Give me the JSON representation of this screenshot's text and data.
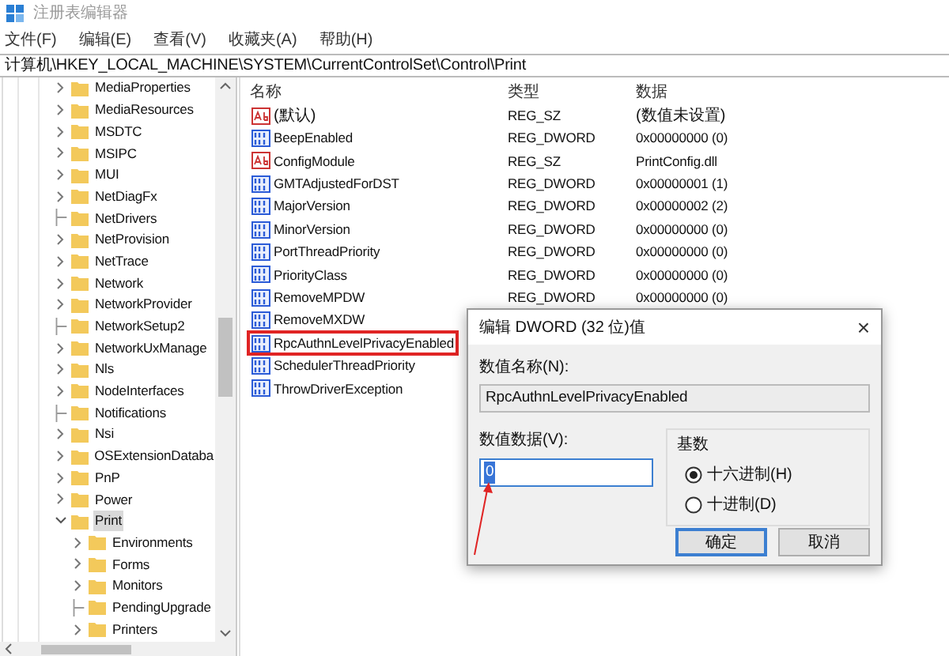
{
  "window": {
    "title": "注册表编辑器"
  },
  "menu": [
    "文件(F)",
    "编辑(E)",
    "查看(V)",
    "收藏夹(A)",
    "帮助(H)"
  ],
  "address": "计算机\\HKEY_LOCAL_MACHINE\\SYSTEM\\CurrentControlSet\\Control\\Print",
  "tree": [
    {
      "label": "MediaProperties",
      "has_children": true
    },
    {
      "label": "MediaResources",
      "has_children": true
    },
    {
      "label": "MSDTC",
      "has_children": true
    },
    {
      "label": "MSIPC",
      "has_children": true
    },
    {
      "label": "MUI",
      "has_children": true
    },
    {
      "label": "NetDiagFx",
      "has_children": true
    },
    {
      "label": "NetDrivers",
      "has_children": false
    },
    {
      "label": "NetProvision",
      "has_children": true
    },
    {
      "label": "NetTrace",
      "has_children": true
    },
    {
      "label": "Network",
      "has_children": true
    },
    {
      "label": "NetworkProvider",
      "has_children": true
    },
    {
      "label": "NetworkSetup2",
      "has_children": false
    },
    {
      "label": "NetworkUxManage",
      "has_children": true
    },
    {
      "label": "Nls",
      "has_children": true
    },
    {
      "label": "NodeInterfaces",
      "has_children": true
    },
    {
      "label": "Notifications",
      "has_children": false
    },
    {
      "label": "Nsi",
      "has_children": true
    },
    {
      "label": "OSExtensionDataba",
      "has_children": true
    },
    {
      "label": "PnP",
      "has_children": true
    },
    {
      "label": "Power",
      "has_children": true
    },
    {
      "label": "Print",
      "has_children": true,
      "expanded": true,
      "selected": true,
      "children": [
        {
          "label": "Environments",
          "has_children": true
        },
        {
          "label": "Forms",
          "has_children": true
        },
        {
          "label": "Monitors",
          "has_children": true
        },
        {
          "label": "PendingUpgrade",
          "has_children": false
        },
        {
          "label": "Printers",
          "has_children": true
        }
      ]
    }
  ],
  "table": {
    "columns": [
      "名称",
      "类型",
      "数据"
    ],
    "rows": [
      {
        "kind": "string",
        "name": "(默认)",
        "type": "REG_SZ",
        "data": "(数值未设置)",
        "highlighted": false
      },
      {
        "kind": "binary",
        "name": "BeepEnabled",
        "type": "REG_DWORD",
        "data": "0x00000000 (0)",
        "highlighted": false
      },
      {
        "kind": "string",
        "name": "ConfigModule",
        "type": "REG_SZ",
        "data": "PrintConfig.dll",
        "highlighted": false
      },
      {
        "kind": "binary",
        "name": "GMTAdjustedForDST",
        "type": "REG_DWORD",
        "data": "0x00000001 (1)",
        "highlighted": false
      },
      {
        "kind": "binary",
        "name": "MajorVersion",
        "type": "REG_DWORD",
        "data": "0x00000002 (2)",
        "highlighted": false
      },
      {
        "kind": "binary",
        "name": "MinorVersion",
        "type": "REG_DWORD",
        "data": "0x00000000 (0)",
        "highlighted": false
      },
      {
        "kind": "binary",
        "name": "PortThreadPriority",
        "type": "REG_DWORD",
        "data": "0x00000000 (0)",
        "highlighted": false
      },
      {
        "kind": "binary",
        "name": "PriorityClass",
        "type": "REG_DWORD",
        "data": "0x00000000 (0)",
        "highlighted": false
      },
      {
        "kind": "binary",
        "name": "RemoveMPDW",
        "type": "REG_DWORD",
        "data": "0x00000000 (0)",
        "highlighted": false
      },
      {
        "kind": "binary",
        "name": "RemoveMXDW",
        "highlighted": false
      },
      {
        "kind": "binary",
        "name": "RpcAuthnLevelPrivacyEnabled",
        "highlighted": true
      },
      {
        "kind": "binary",
        "name": "SchedulerThreadPriority",
        "highlighted": false
      },
      {
        "kind": "binary",
        "name": "ThrowDriverException",
        "highlighted": false
      }
    ]
  },
  "dialog": {
    "title": "编辑 DWORD (32 位)值",
    "close": "×",
    "name_label": "数值名称(N):",
    "name_value": "RpcAuthnLevelPrivacyEnabled",
    "data_label": "数值数据(V):",
    "data_value": "0",
    "base_label": "基数",
    "bases": [
      {
        "label": "十六进制(H)",
        "selected": true
      },
      {
        "label": "十进制(D)",
        "selected": false
      }
    ],
    "buttons": [
      {
        "label": "确定",
        "default": true
      },
      {
        "label": "取消",
        "default": false
      }
    ]
  }
}
